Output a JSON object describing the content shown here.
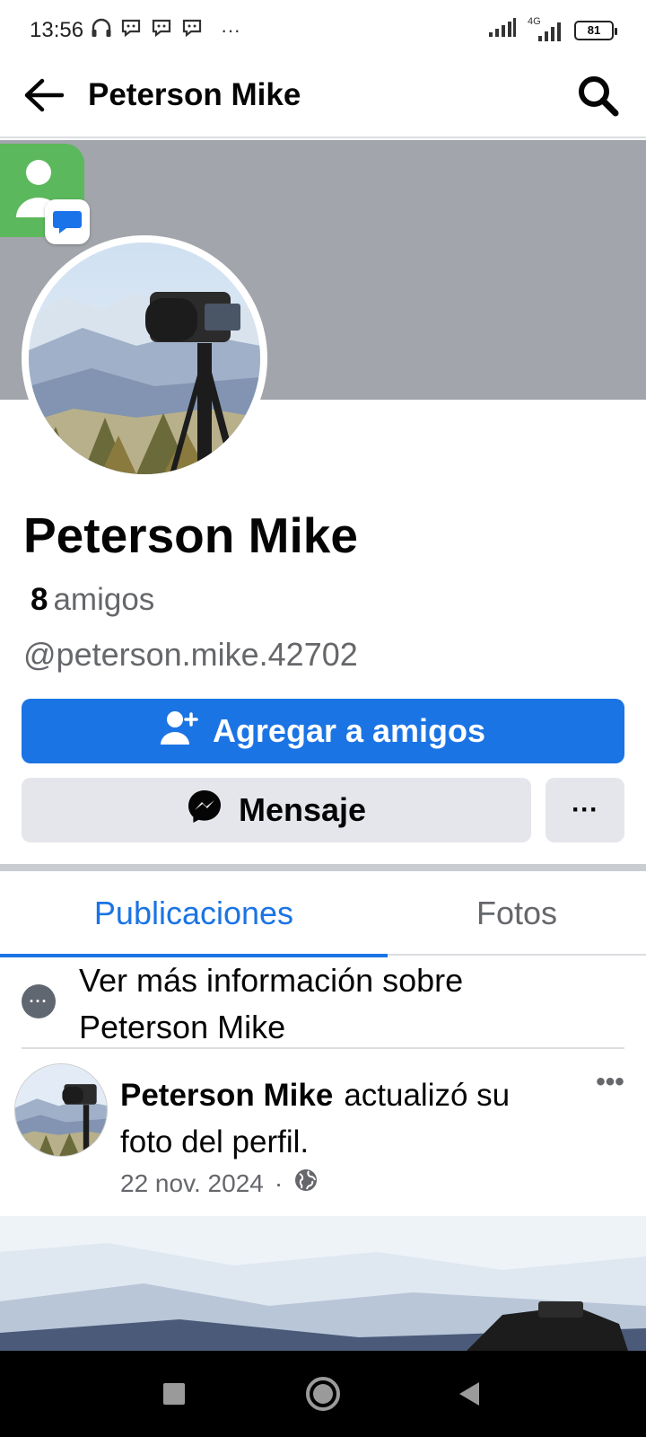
{
  "status_bar": {
    "time": "13:56",
    "battery": "81",
    "network": "4G",
    "overflow": "···",
    "icons": [
      "headphones-icon",
      "chat-icon",
      "chat-icon",
      "chat-icon",
      "signal-icon",
      "signal-4g-icon",
      "battery-icon"
    ]
  },
  "header": {
    "title": "Peterson Mike",
    "back_icon": "arrow-left-icon",
    "search_icon": "search-icon"
  },
  "floating_app": {
    "icon": "contacts-icon",
    "badge_icon": "messages-icon",
    "colors": {
      "background": "#5cb85c",
      "badge": "#1a73e8"
    }
  },
  "profile": {
    "name": "Peterson Mike",
    "friends_count": "8",
    "friends_label": "amigos",
    "username": "@peterson.mike.42702",
    "cover_color": "#a2a5ab"
  },
  "actions": {
    "add_friend_label": "Agregar a amigos",
    "message_label": "Mensaje",
    "more_label": "···",
    "colors": {
      "primary": "#1b74e4",
      "secondary": "#e4e6eb"
    }
  },
  "tabs": [
    {
      "label": "Publicaciones",
      "active": true
    },
    {
      "label": "Fotos",
      "active": false
    }
  ],
  "info": {
    "line1": "Ver más información sobre",
    "line2": "Peterson Mike",
    "icon_text": "···"
  },
  "post": {
    "author": "Peterson Mike",
    "action": "actualizó su foto del perfil.",
    "date": "22 nov. 2024",
    "separator": "·",
    "privacy_icon": "globe-icon",
    "menu_label": "•••"
  },
  "system_nav": {
    "icons": [
      "recents-square-icon",
      "home-circle-icon",
      "back-triangle-icon"
    ]
  }
}
